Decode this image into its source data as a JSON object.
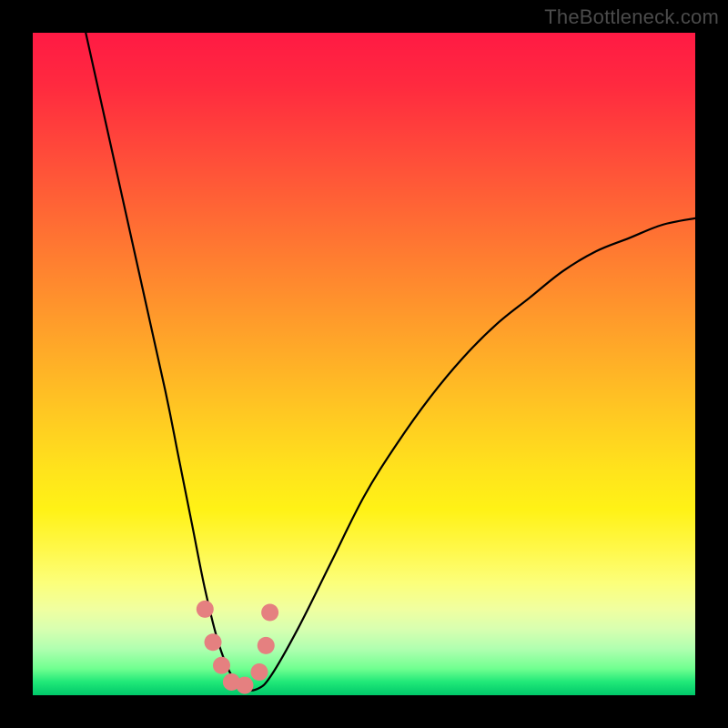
{
  "watermark": "TheBottleneck.com",
  "colors": {
    "frame": "#000000",
    "curve_stroke": "#000000",
    "marker_fill": "#e58080",
    "gradient_top": "#ff1a44",
    "gradient_bottom": "#00c86a"
  },
  "chart_data": {
    "type": "line",
    "title": "",
    "xlabel": "",
    "ylabel": "",
    "xlim": [
      0,
      100
    ],
    "ylim": [
      0,
      100
    ],
    "grid": false,
    "legend": false,
    "series": [
      {
        "name": "bottleneck-curve",
        "x": [
          8,
          12,
          16,
          20,
          22,
          24,
          26,
          28,
          30,
          32,
          34,
          36,
          40,
          45,
          50,
          55,
          60,
          65,
          70,
          75,
          80,
          85,
          90,
          95,
          100
        ],
        "y": [
          100,
          82,
          64,
          46,
          36,
          26,
          16,
          8,
          3,
          1,
          1,
          3,
          10,
          20,
          30,
          38,
          45,
          51,
          56,
          60,
          64,
          67,
          69,
          71,
          72
        ]
      }
    ],
    "markers": {
      "name": "highlight-points",
      "x": [
        26.0,
        27.2,
        28.5,
        30.0,
        32.0,
        34.2,
        35.2,
        35.8
      ],
      "y": [
        13.0,
        8.0,
        4.5,
        2.0,
        1.5,
        3.5,
        7.5,
        12.5
      ]
    }
  }
}
